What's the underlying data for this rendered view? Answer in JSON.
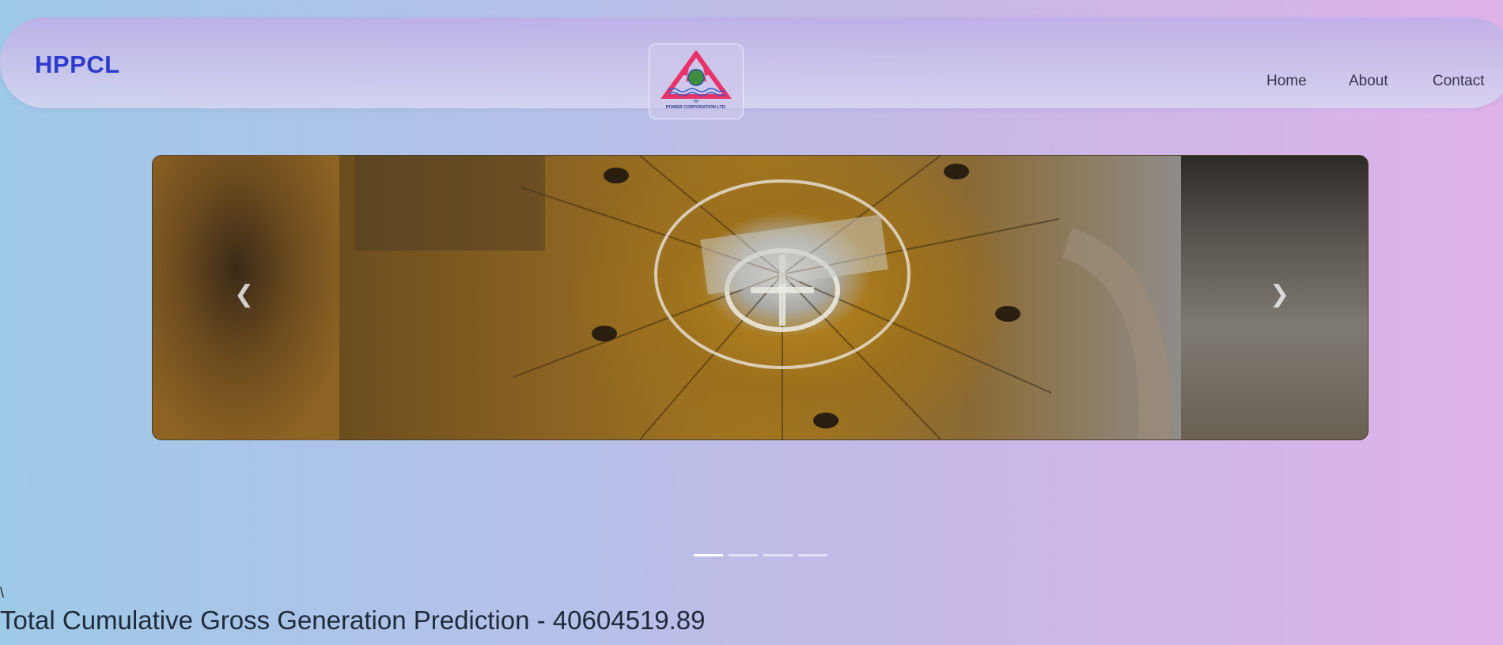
{
  "header": {
    "brand": "HPPCL",
    "logo": {
      "icon": "hppcl-logo-icon",
      "caption_top": "HP",
      "caption": "POWER CORPORATION LTD."
    },
    "nav": [
      {
        "label": "Home"
      },
      {
        "label": "About"
      },
      {
        "label": "Contact"
      }
    ]
  },
  "carousel": {
    "prev_icon": "chevron-left-icon",
    "next_icon": "chevron-right-icon",
    "prev_glyph": "❮",
    "next_glyph": "❯",
    "slide_count": 4,
    "active_index": 0
  },
  "stray_text": "\\",
  "prediction": {
    "text": "Total Cumulative Gross Generation Prediction - 40604519.89"
  },
  "colors": {
    "brand": "#2d3ccc",
    "accent_logo": "#e8336a"
  }
}
